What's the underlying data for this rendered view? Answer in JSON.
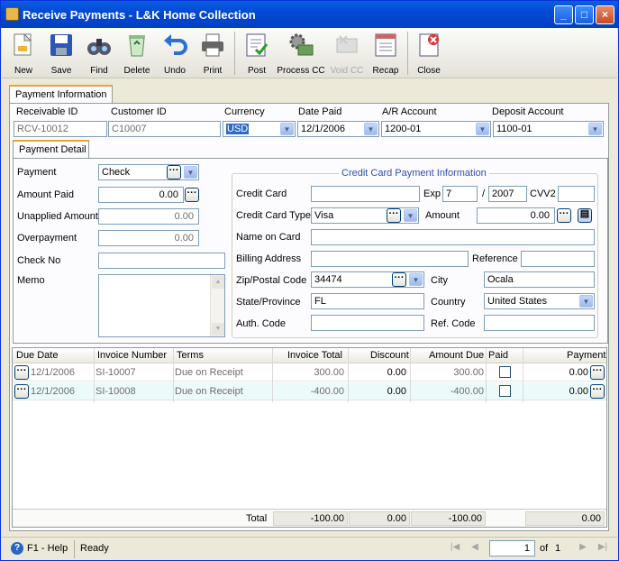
{
  "window": {
    "title": "Receive Payments - L&K Home Collection"
  },
  "toolbar": {
    "new": "New",
    "save": "Save",
    "find": "Find",
    "delete": "Delete",
    "undo": "Undo",
    "print": "Print",
    "post": "Post",
    "process_cc": "Process CC",
    "void_cc": "Void CC",
    "recap": "Recap",
    "close": "Close"
  },
  "tabs": {
    "payment_information": "Payment Information",
    "payment_detail": "Payment Detail"
  },
  "header": {
    "receivable_id_label": "Receivable ID",
    "receivable_id": "RCV-10012",
    "customer_id_label": "Customer ID",
    "customer_id": "C10007",
    "currency_label": "Currency",
    "currency": "USD",
    "date_paid_label": "Date Paid",
    "date_paid": "12/1/2006",
    "ar_account_label": "A/R Account",
    "ar_account": "1200-01",
    "deposit_account_label": "Deposit Account",
    "deposit_account": "1100-01"
  },
  "detail": {
    "payment_label": "Payment",
    "payment": "Check",
    "amount_paid_label": "Amount Paid",
    "amount_paid": "0.00",
    "unapplied_label": "Unapplied Amount",
    "unapplied": "0.00",
    "overpayment_label": "Overpayment",
    "overpayment": "0.00",
    "check_no_label": "Check No",
    "check_no": "",
    "memo_label": "Memo",
    "memo": ""
  },
  "credit_card": {
    "group_title": "Credit Card Payment Information",
    "card_label": "Credit Card",
    "card": "",
    "exp_label": "Exp",
    "exp_month": "7",
    "exp_sep": "/",
    "exp_year": "2007",
    "cvv_label": "CVV2",
    "cvv": "",
    "type_label": "Credit Card Type",
    "type": "Visa",
    "amount_label": "Amount",
    "amount": "0.00",
    "name_label": "Name on Card",
    "name": "",
    "billing_label": "Billing Address",
    "billing": "",
    "reference_label": "Reference",
    "reference": "",
    "zip_label": "Zip/Postal Code",
    "zip": "34474",
    "city_label": "City",
    "city": "Ocala",
    "state_label": "State/Province",
    "state": "FL",
    "country_label": "Country",
    "country": "United States",
    "auth_label": "Auth. Code",
    "auth": "",
    "ref_code_label": "Ref. Code",
    "ref_code": ""
  },
  "grid": {
    "columns": {
      "due_date": "Due Date",
      "invoice": "Invoice Number",
      "terms": "Terms",
      "total": "Invoice Total",
      "discount": "Discount",
      "amount_due": "Amount Due",
      "paid": "Paid",
      "payment": "Payment"
    },
    "rows": [
      {
        "due_date": "12/1/2006",
        "invoice": "SI-10007",
        "terms": "Due on Receipt",
        "total": "300.00",
        "discount": "0.00",
        "amount_due": "300.00",
        "payment": "0.00"
      },
      {
        "due_date": "12/1/2006",
        "invoice": "SI-10008",
        "terms": "Due on Receipt",
        "total": "-400.00",
        "discount": "0.00",
        "amount_due": "-400.00",
        "payment": "0.00"
      }
    ],
    "footer": {
      "label": "Total",
      "total": "-100.00",
      "discount": "0.00",
      "amount_due": "-100.00",
      "payment": "0.00"
    }
  },
  "status": {
    "help": "F1 - Help",
    "state": "Ready",
    "page": "1",
    "of_label": "of",
    "page_count": "1"
  },
  "colors": {
    "title_bar": "#0349d6",
    "window_bg": "#ece9d8",
    "alt_row": "#edfafa",
    "group_title": "#2b50b2"
  }
}
